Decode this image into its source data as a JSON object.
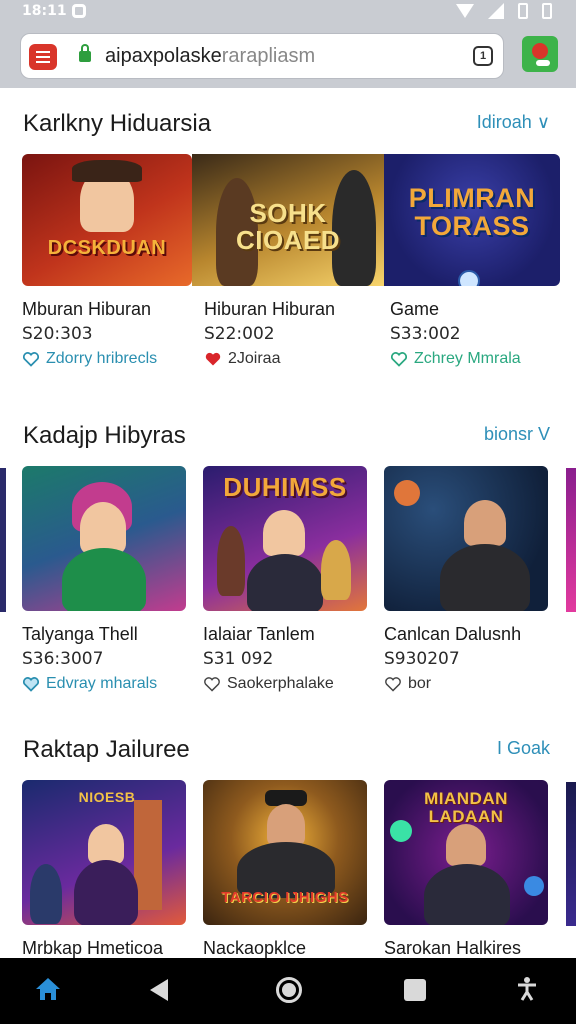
{
  "status_bar": {
    "time": "18:11",
    "icons": [
      "gear-icon",
      "wifi-icon",
      "signal-icon",
      "battery-icon"
    ]
  },
  "browser": {
    "url_main": "aipaxpolaske",
    "url_dim": "rarapliasm",
    "tab_count": "1"
  },
  "sections": [
    {
      "title": "Karlkny Hiduarsia",
      "link": "Idiroah ∨",
      "cards": [
        {
          "thumb_text": "DCSKDUAN",
          "name": "Mburan Hiburan",
          "price": "S20:303",
          "meta": "Zdorry hribrecls",
          "heart": "outline",
          "palette": [
            "#7a1410",
            "#c0341c",
            "#f4b23a"
          ]
        },
        {
          "thumb_text": "SOHK CIOAED",
          "name": "Hiburan Hiburan",
          "price": "S22:002",
          "meta": "2Joiraa",
          "heart": "filled",
          "palette": [
            "#3a2a18",
            "#b8862e",
            "#f7d46c"
          ]
        },
        {
          "thumb_text": "PLIMRAN TORASS",
          "name": "Game",
          "price": "S33:002",
          "meta": "Zchrey Mmrala",
          "heart": "outline-green",
          "palette": [
            "#1c1f6a",
            "#3a3fa8",
            "#f2a83a"
          ]
        }
      ]
    },
    {
      "title": "Kadajp Hibyras",
      "link": "bionsr V",
      "cards": [
        {
          "thumb_text": "",
          "name": "Talyanga Thell",
          "price": "S36:3007",
          "meta": "Edvray mharals",
          "heart": "outline-blue",
          "palette": [
            "#1c7a6a",
            "#c23c8e",
            "#f2c246"
          ]
        },
        {
          "thumb_text": "DUHIMSS",
          "name": "Ialaiar Tanlem",
          "price": "S31 092",
          "meta": "Saokerphalake",
          "heart": "outline-dark",
          "palette": [
            "#2a1c6e",
            "#8a2e9e",
            "#f2a83a"
          ]
        },
        {
          "thumb_text": "",
          "name": "Canlcan Dalusnh",
          "price": "S930207",
          "meta": "bor",
          "heart": "outline-dark",
          "palette": [
            "#10203a",
            "#2a4e7a",
            "#e0763a"
          ]
        }
      ]
    },
    {
      "title": "Raktap Jailuree",
      "link": "I Goak",
      "cards": [
        {
          "thumb_text": "NIOESB",
          "name": "Mrbkap Hmeticoa",
          "price": "",
          "meta": "",
          "heart": "",
          "palette": [
            "#1a2a6e",
            "#6a2a9e",
            "#e25a3a"
          ]
        },
        {
          "thumb_text": "TARCIO IJHIGHS",
          "name": "Nackaopklce",
          "price": "",
          "meta": "",
          "heart": "",
          "palette": [
            "#3a2410",
            "#8e5a1e",
            "#f2b23a"
          ]
        },
        {
          "thumb_text": "MIANDAN LADAAN",
          "name": "Sarokan Halkires",
          "price": "",
          "meta": "",
          "heart": "",
          "palette": [
            "#2a0e4e",
            "#7a1e8e",
            "#3ae2a6"
          ]
        }
      ]
    }
  ],
  "nav": {
    "items": [
      "home-icon",
      "back-icon",
      "home-circle-icon",
      "recents-icon",
      "accessibility-icon"
    ],
    "accent": "#2a8fd8"
  }
}
